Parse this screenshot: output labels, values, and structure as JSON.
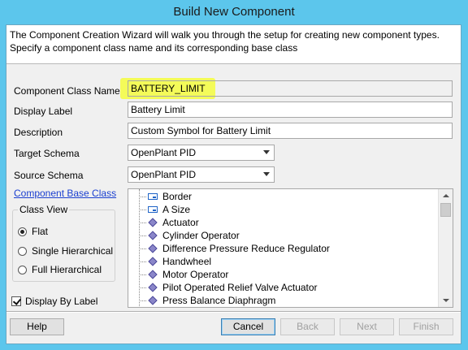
{
  "window": {
    "title": "Build New Component"
  },
  "header": {
    "description": "The Component Creation Wizard will walk you through the setup for creating new component types.  Specify a component class name and its corresponding base class"
  },
  "form": {
    "component_class_name": {
      "label": "Component Class Name",
      "value": "BATTERY_LIMIT"
    },
    "display_label": {
      "label": "Display Label",
      "value": "Battery Limit"
    },
    "description": {
      "label": "Description",
      "value": "Custom Symbol for Battery Limit"
    },
    "target_schema": {
      "label": "Target Schema",
      "value": "OpenPlant PID"
    },
    "source_schema": {
      "label": "Source Schema",
      "value": "OpenPlant PID"
    }
  },
  "base_class": {
    "link_label": "Component Base Class",
    "items": [
      {
        "label": "Border",
        "icon": "frame-icon"
      },
      {
        "label": "A Size",
        "icon": "frame-icon"
      },
      {
        "label": "Actuator",
        "icon": "diamond-icon"
      },
      {
        "label": "Cylinder Operator",
        "icon": "diamond-icon"
      },
      {
        "label": "Difference Pressure Reduce Regulator",
        "icon": "diamond-icon"
      },
      {
        "label": "Handwheel",
        "icon": "diamond-icon"
      },
      {
        "label": "Motor Operator",
        "icon": "diamond-icon"
      },
      {
        "label": "Pilot Operated Relief Valve Actuator",
        "icon": "diamond-icon"
      },
      {
        "label": "Press Balance Diaphragm",
        "icon": "diamond-icon"
      }
    ]
  },
  "class_view": {
    "title": "Class View",
    "options": [
      {
        "label": "Flat",
        "selected": true
      },
      {
        "label": "Single Hierarchical",
        "selected": false
      },
      {
        "label": "Full Hierarchical",
        "selected": false
      }
    ],
    "display_by_label": {
      "label": "Display By Label",
      "checked": true
    }
  },
  "buttons": {
    "help": "Help",
    "cancel": "Cancel",
    "back": "Back",
    "next": "Next",
    "finish": "Finish"
  },
  "colors": {
    "title_bar": "#5cc6ec",
    "highlight": "#f4fb59",
    "link": "#1a3fd0"
  }
}
